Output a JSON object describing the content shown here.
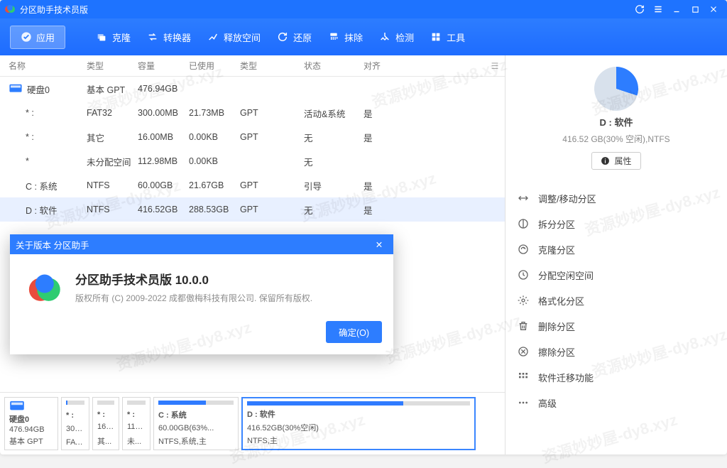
{
  "title": "分区助手技术员版",
  "toolbar": {
    "apply": "应用",
    "items": [
      {
        "id": "clone",
        "label": "克隆"
      },
      {
        "id": "convert",
        "label": "转换器"
      },
      {
        "id": "freespace",
        "label": "释放空间"
      },
      {
        "id": "restore",
        "label": "还原"
      },
      {
        "id": "wipe",
        "label": "抹除"
      },
      {
        "id": "check",
        "label": "检测"
      },
      {
        "id": "tools",
        "label": "工具"
      }
    ]
  },
  "columns": {
    "name": "名称",
    "type": "类型",
    "capacity": "容量",
    "used": "已使用",
    "ptype": "类型",
    "status": "状态",
    "align": "对齐"
  },
  "disk": {
    "label": "硬盘0",
    "type": "基本 GPT",
    "capacity": "476.94GB"
  },
  "parts": [
    {
      "name": "* :",
      "type": "FAT32",
      "cap": "300.00MB",
      "used": "21.73MB",
      "ptype": "GPT",
      "status": "活动&系统",
      "align": "是"
    },
    {
      "name": "* :",
      "type": "其它",
      "cap": "16.00MB",
      "used": "0.00KB",
      "ptype": "GPT",
      "status": "无",
      "align": "是"
    },
    {
      "name": "*",
      "type": "未分配空间",
      "cap": "112.98MB",
      "used": "0.00KB",
      "ptype": "",
      "status": "无",
      "align": ""
    },
    {
      "name": "C : 系统",
      "type": "NTFS",
      "cap": "60.00GB",
      "used": "21.67GB",
      "ptype": "GPT",
      "status": "引导",
      "align": "是"
    },
    {
      "name": "D : 软件",
      "type": "NTFS",
      "cap": "416.52GB",
      "used": "288.53GB",
      "ptype": "GPT",
      "status": "无",
      "align": "是",
      "sel": true
    }
  ],
  "bottom": {
    "disk": {
      "name": "硬盘0",
      "cap": "476.94GB",
      "type": "基本 GPT"
    },
    "cards": [
      {
        "title": "* :",
        "l1": "300...",
        "l2": "FAT...",
        "pct": 7
      },
      {
        "title": "* :",
        "l1": "16....",
        "l2": "其...",
        "pct": 0
      },
      {
        "title": "* :",
        "l1": "112...",
        "l2": "未...",
        "pct": 0
      },
      {
        "title": "C : 系统",
        "l1": "60.00GB(63%...",
        "l2": "NTFS,系统,主",
        "pct": 63
      },
      {
        "title": "D : 软件",
        "l1": "416.52GB(30%空闲)",
        "l2": "NTFS,主",
        "pct": 70,
        "sel": true
      }
    ]
  },
  "side": {
    "pname": "D : 软件",
    "pdetail": "416.52 GB(30% 空闲),NTFS",
    "attr": "属性",
    "ops": [
      {
        "id": "resize",
        "label": "调整/移动分区"
      },
      {
        "id": "split",
        "label": "拆分分区"
      },
      {
        "id": "clone",
        "label": "克隆分区"
      },
      {
        "id": "alloc",
        "label": "分配空闲空间"
      },
      {
        "id": "format",
        "label": "格式化分区"
      },
      {
        "id": "delete",
        "label": "删除分区"
      },
      {
        "id": "wipe",
        "label": "擦除分区"
      },
      {
        "id": "migrate",
        "label": "软件迁移功能"
      },
      {
        "id": "more",
        "label": "高级"
      }
    ]
  },
  "modal": {
    "title": "关于版本 分区助手",
    "heading": "分区助手技术员版 10.0.0",
    "copy": "版权所有 (C) 2009-2022 成都傲梅科技有限公司. 保留所有版权.",
    "ok": "确定(O)"
  },
  "watermark": "资源妙妙屋-dy8.xyz"
}
